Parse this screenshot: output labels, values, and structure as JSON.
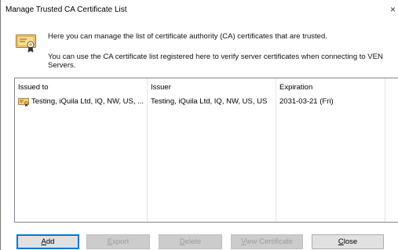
{
  "window": {
    "title": "Manage Trusted CA Certificate List",
    "close_glyph": "×"
  },
  "message": {
    "line1": "Here you can manage the list of certificate authority (CA) certificates that are trusted.",
    "line2": "You can use the CA certificate list registered here to verify server certificates when connecting to VEN",
    "line3": "Servers.",
    "icon": "certificate-icon"
  },
  "list": {
    "columns": [
      "Issued to",
      "Issuer",
      "Expiration"
    ],
    "rows": [
      {
        "issued_to": "Testing, iQuila Ltd, IQ, NW, US, ...",
        "issuer": "Testing, iQuila Ltd, IQ, NW, US, US",
        "expiration": "2031-03-21 (Fri)",
        "icon": "certificate-icon"
      }
    ]
  },
  "buttons": {
    "add": {
      "first": "A",
      "rest": "dd"
    },
    "export": {
      "first": "E",
      "rest": "xport"
    },
    "delete": {
      "first": "D",
      "rest": "elete"
    },
    "view_certificate": {
      "first": "V",
      "rest": "iew Certificate"
    },
    "close": {
      "first": "C",
      "rest": "lose"
    }
  },
  "colors": {
    "accent": "#0078d7",
    "cert_icon": "#d9a441"
  }
}
